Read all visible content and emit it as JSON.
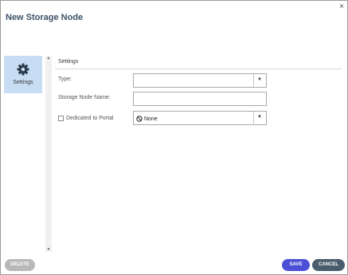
{
  "dialog": {
    "title": "New Storage Node",
    "close_glyph": "×"
  },
  "nav": {
    "items": [
      {
        "label": "Settings",
        "icon": "gear-icon",
        "selected": true
      }
    ]
  },
  "section": {
    "title": "Settings"
  },
  "form": {
    "type_label": "Type:",
    "type_value": "",
    "storage_node_name_label": "Storage Node Name:",
    "storage_node_name_value": "",
    "dedicated_label": "Dedicated to Portal",
    "dedicated_checked": false,
    "dedicated_value": "None"
  },
  "footer": {
    "delete_label": "DELETE",
    "save_label": "SAVE",
    "cancel_label": "CANCEL"
  },
  "colors": {
    "title": "#3d5166",
    "nav_selected_bg": "#c6ddf4",
    "save_button": "#4a4fd6",
    "cancel_button": "#495d6e",
    "delete_button": "#b8b8b8"
  }
}
